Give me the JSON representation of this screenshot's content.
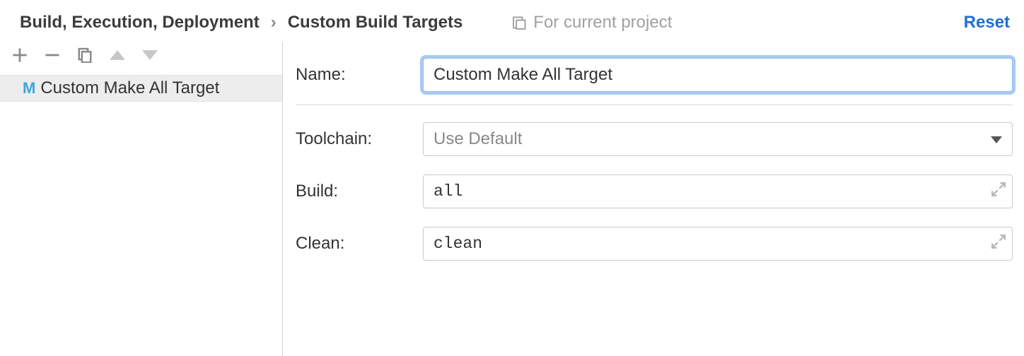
{
  "breadcrumb": {
    "root": "Build, Execution, Deployment",
    "page": "Custom Build Targets"
  },
  "scope_label": "For current project",
  "reset_label": "Reset",
  "sidebar": {
    "items": [
      {
        "label": "Custom Make All Target"
      }
    ]
  },
  "form": {
    "name_label": "Name:",
    "name_value": "Custom Make All Target",
    "toolchain_label": "Toolchain:",
    "toolchain_value": "Use Default",
    "build_label": "Build:",
    "build_value": "all",
    "clean_label": "Clean:",
    "clean_value": "clean"
  }
}
